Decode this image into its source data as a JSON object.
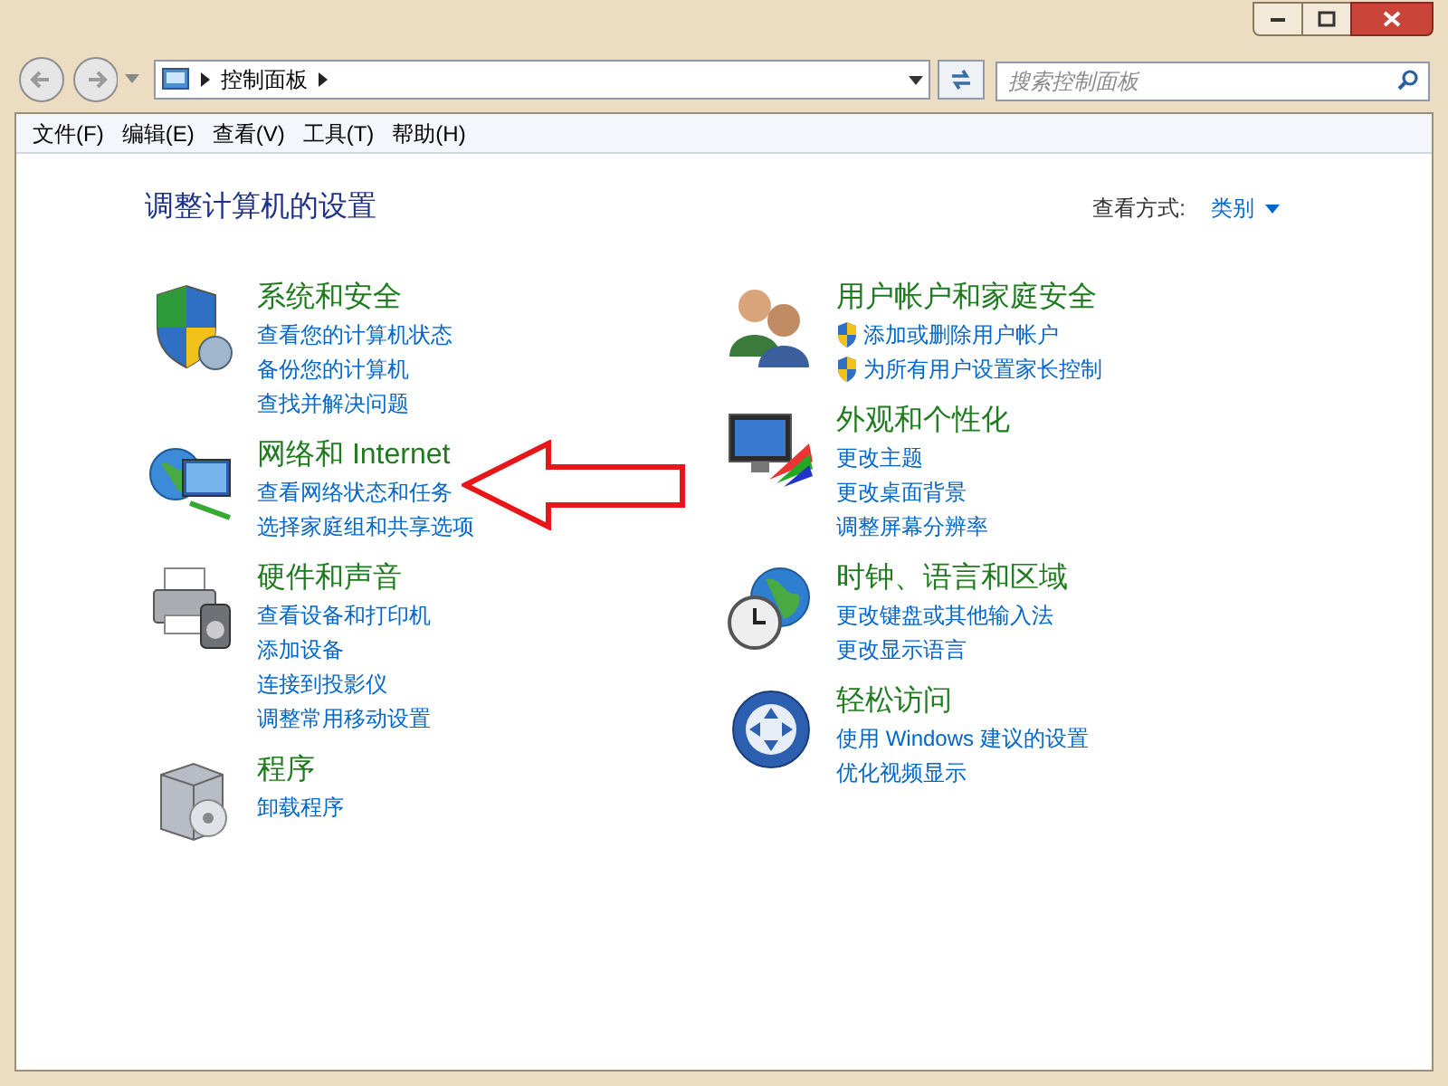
{
  "address_bar": {
    "breadcrumb": [
      "控制面板"
    ]
  },
  "search": {
    "placeholder": "搜索控制面板"
  },
  "menu": [
    "文件(F)",
    "编辑(E)",
    "查看(V)",
    "工具(T)",
    "帮助(H)"
  ],
  "heading": "调整计算机的设置",
  "view_by": {
    "label": "查看方式:",
    "value": "类别"
  },
  "columns": [
    [
      {
        "title": "系统和安全",
        "links": [
          {
            "text": "查看您的计算机状态",
            "kind": "link"
          },
          {
            "text": "备份您的计算机",
            "kind": "link"
          },
          {
            "text": "查找并解决问题",
            "kind": "link"
          }
        ]
      },
      {
        "title": "网络和 Internet",
        "links": [
          {
            "text": "查看网络状态和任务",
            "kind": "link"
          },
          {
            "text": "选择家庭组和共享选项",
            "kind": "link"
          }
        ]
      },
      {
        "title": "硬件和声音",
        "links": [
          {
            "text": "查看设备和打印机",
            "kind": "link"
          },
          {
            "text": "添加设备",
            "kind": "link"
          },
          {
            "text": "连接到投影仪",
            "kind": "link"
          },
          {
            "text": "调整常用移动设置",
            "kind": "link"
          }
        ]
      },
      {
        "title": "程序",
        "links": [
          {
            "text": "卸载程序",
            "kind": "link"
          }
        ]
      }
    ],
    [
      {
        "title": "用户帐户和家庭安全",
        "links": [
          {
            "text": "添加或删除用户帐户",
            "kind": "shield"
          },
          {
            "text": "为所有用户设置家长控制",
            "kind": "shield"
          }
        ]
      },
      {
        "title": "外观和个性化",
        "links": [
          {
            "text": "更改主题",
            "kind": "link"
          },
          {
            "text": "更改桌面背景",
            "kind": "link"
          },
          {
            "text": "调整屏幕分辨率",
            "kind": "link"
          }
        ]
      },
      {
        "title": "时钟、语言和区域",
        "links": [
          {
            "text": "更改键盘或其他输入法",
            "kind": "link"
          },
          {
            "text": "更改显示语言",
            "kind": "link"
          }
        ]
      },
      {
        "title": "轻松访问",
        "links": [
          {
            "text": "使用 Windows 建议的设置",
            "kind": "link"
          },
          {
            "text": "优化视频显示",
            "kind": "link"
          }
        ]
      }
    ]
  ],
  "annotation": {
    "kind": "arrow"
  }
}
